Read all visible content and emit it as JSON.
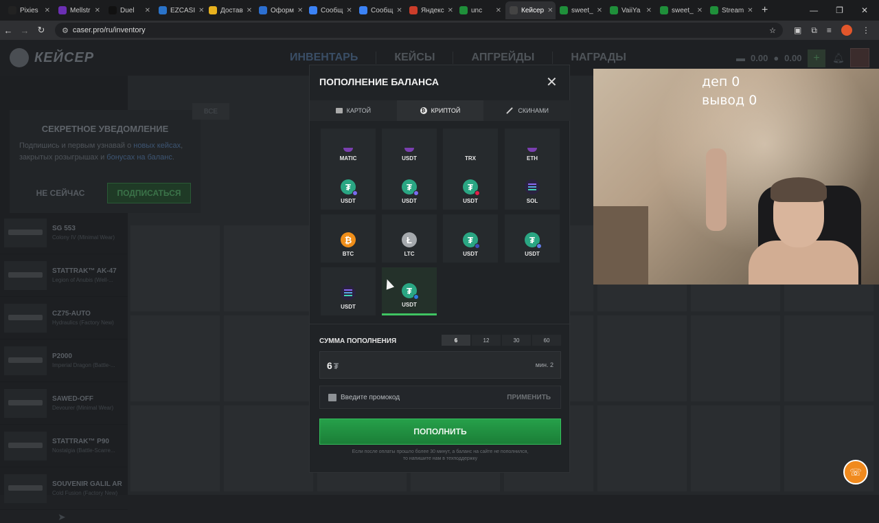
{
  "browser": {
    "tabs": [
      {
        "title": "Pixies",
        "color": "#222"
      },
      {
        "title": "Mellstr",
        "color": "#6b2fb3"
      },
      {
        "title": "Duel",
        "color": "#111"
      },
      {
        "title": "EZCASI",
        "color": "#2a73c9"
      },
      {
        "title": "Достав",
        "color": "#e8b21e"
      },
      {
        "title": "Оформ",
        "color": "#2c6fd1"
      },
      {
        "title": "Сообщ",
        "color": "#3b82f6"
      },
      {
        "title": "Сообщ",
        "color": "#3b82f6"
      },
      {
        "title": "Яндекс",
        "color": "#cc3d2a"
      },
      {
        "title": "unc",
        "color": "#1f8f3a"
      },
      {
        "title": "Кейсер",
        "color": "#444"
      },
      {
        "title": "sweet_",
        "color": "#1f8f3a"
      },
      {
        "title": "VaiiYa",
        "color": "#1f8f3a"
      },
      {
        "title": "sweet_",
        "color": "#1f8f3a"
      },
      {
        "title": "Stream",
        "color": "#1f8f3a"
      }
    ],
    "active_tab": 10,
    "url": "caser.pro/ru/inventory"
  },
  "site": {
    "logo_text": "КЕЙСЕР",
    "nav": [
      "ИНВЕНТАРЬ",
      "КЕЙСЫ",
      "АПГРЕЙДЫ",
      "НАГРАДЫ"
    ],
    "balance_1": "0.00",
    "balance_2": "0.00",
    "notif_badge": "1"
  },
  "notification": {
    "title": "СЕКРЕТНОЕ УВЕДОМЛЕНИЕ",
    "text_1": "Подпишись и первым узнавай о ",
    "link_1": "новых кейсах",
    "text_2": ", закрытых розыгрышах и ",
    "link_2": "бонусах на баланс",
    "text_3": ".",
    "decline": "НЕ СЕЙЧАС",
    "accept": "ПОДПИСАТЬСЯ",
    "all_label": "ВСЕ"
  },
  "inventory": [
    {
      "name": "SG 553",
      "sub": "Colony IV (Minimal Wear)"
    },
    {
      "name": "STATTRAK™ AK-47",
      "sub": "Legion of Anubis (Well-..."
    },
    {
      "name": "CZ75-AUTO",
      "sub": "Hydraulics (Factory New)"
    },
    {
      "name": "P2000",
      "sub": "Imperial Dragon (Battle-..."
    },
    {
      "name": "SAWED-OFF",
      "sub": "Devourer (Minimal Wear)"
    },
    {
      "name": "STATTRAK™ P90",
      "sub": "Nostalgia (Battle-Scarre..."
    },
    {
      "name": "SOUVENIR GALIL AR",
      "sub": "Cold Fusion (Factory New)"
    }
  ],
  "modal": {
    "title": "ПОПОЛНЕНИЕ БАЛАНСА",
    "tabs": [
      "КАРТОЙ",
      "КРИПТОЙ",
      "СКИНАМИ"
    ],
    "active_tab": 1,
    "coins": [
      {
        "label": "MATIC",
        "icon": "top"
      },
      {
        "label": "USDT",
        "icon": "top"
      },
      {
        "label": "TRX",
        "icon": "none"
      },
      {
        "label": "ETH",
        "icon": "top"
      },
      {
        "label": "USDT",
        "icon": "usdt",
        "badge": "#7b6cf0"
      },
      {
        "label": "USDT",
        "icon": "usdt",
        "badge": "#7b6cf0"
      },
      {
        "label": "USDT",
        "icon": "usdt",
        "badge": "#e0204a"
      },
      {
        "label": "SOL",
        "icon": "sol"
      },
      {
        "label": "BTC",
        "icon": "btc"
      },
      {
        "label": "LTC",
        "icon": "ltc"
      },
      {
        "label": "USDT",
        "icon": "usdt",
        "badge": "#3d4fb8"
      },
      {
        "label": "USDT",
        "icon": "usdt",
        "badge": "#627eea"
      },
      {
        "label": "USDT",
        "icon": "sol"
      },
      {
        "label": "USDT",
        "icon": "usdt",
        "badge": "#2d7ce0",
        "selected": true
      }
    ],
    "sum_label": "СУММА ПОПОЛНЕНИЯ",
    "presets": [
      "6",
      "12",
      "30",
      "60"
    ],
    "active_preset": 0,
    "amount_value": "6",
    "amount_currency": "₮",
    "min_label": "мин. 2",
    "promo_placeholder": "Введите промокод",
    "apply_label": "ПРИМЕНИТЬ",
    "pay_label": "ПОПОЛНИТЬ",
    "note": "Если после оплаты прошло более 30 минут, а баланс на сайте не пополнился, то напишите нам в техподдержку"
  },
  "stream_overlay": {
    "line_1": "деп 0",
    "line_2": "вывод 0"
  }
}
